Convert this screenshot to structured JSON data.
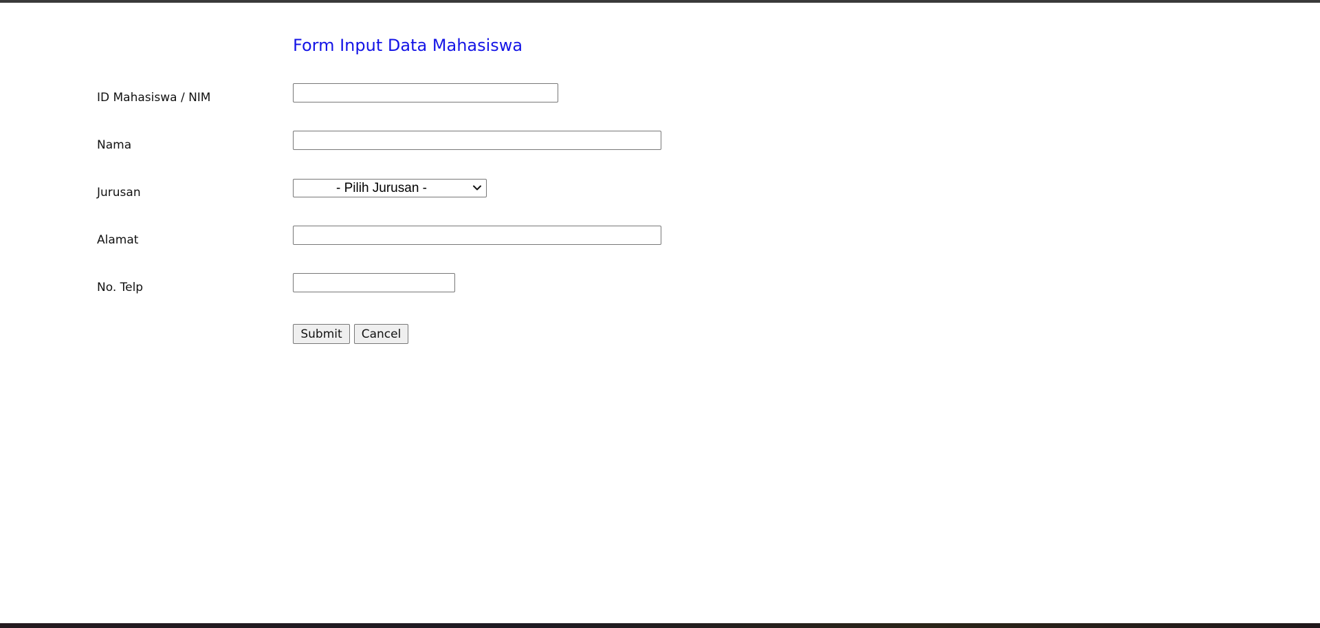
{
  "form": {
    "title": "Form Input Data Mahasiswa",
    "fields": {
      "nim": {
        "label": "ID Mahasiswa / NIM",
        "value": "",
        "placeholder": ""
      },
      "nama": {
        "label": "Nama",
        "value": "",
        "placeholder": ""
      },
      "jurusan": {
        "label": "Jurusan",
        "selected": "- Pilih Jurusan -"
      },
      "alamat": {
        "label": "Alamat",
        "value": "",
        "placeholder": ""
      },
      "telp": {
        "label": "No. Telp",
        "value": "",
        "placeholder": ""
      }
    },
    "buttons": {
      "submit_label": "Submit",
      "cancel_label": "Cancel"
    }
  },
  "colors": {
    "title": "#1414e6",
    "button_bg": "#efefef",
    "input_border": "#767676"
  },
  "icons": {
    "select_chevron": "chevron-down-icon"
  }
}
